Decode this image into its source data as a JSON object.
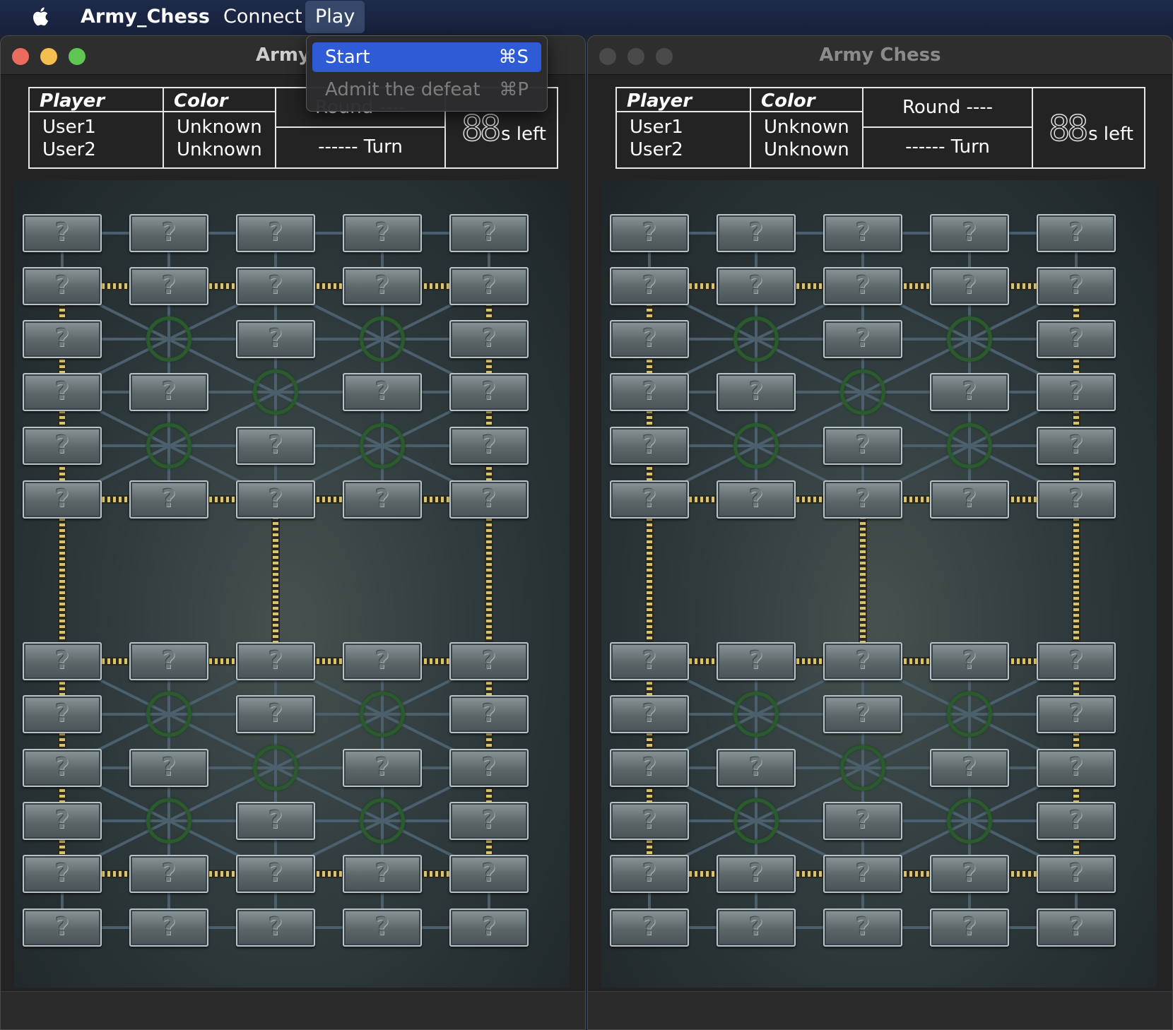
{
  "menubar": {
    "apple_icon": "apple-logo-icon",
    "app_name": "Army_Chess",
    "items": [
      "Connect",
      "Play"
    ]
  },
  "play_menu": {
    "items": [
      {
        "label": "Start",
        "shortcut": "⌘S",
        "enabled": true,
        "highlighted": true
      },
      {
        "label": "Admit the defeat",
        "shortcut": "⌘P",
        "enabled": false,
        "highlighted": false
      }
    ]
  },
  "windows": [
    {
      "title": "Army Chess",
      "title_visible": "Army C",
      "active": true,
      "info": {
        "player_header": "Player",
        "color_header": "Color",
        "players": [
          "User1",
          "User2"
        ],
        "colors": [
          "Unknown",
          "Unknown"
        ],
        "round": "Round ----",
        "turn": "------ Turn",
        "timer_digits": "88",
        "timer_label": "s left"
      }
    },
    {
      "title": "Army Chess",
      "title_visible": "Army Chess",
      "active": false,
      "info": {
        "player_header": "Player",
        "color_header": "Color",
        "players": [
          "User1",
          "User2"
        ],
        "colors": [
          "Unknown",
          "Unknown"
        ],
        "round": "Round ----",
        "turn": "------ Turn",
        "timer_digits": "88",
        "timer_label": "s left"
      }
    }
  ],
  "board": {
    "columns": 5,
    "rows": 12,
    "piece_label": "?",
    "camp_positions": [
      [
        2,
        1
      ],
      [
        2,
        3
      ],
      [
        3,
        2
      ],
      [
        4,
        1
      ],
      [
        4,
        3
      ],
      [
        7,
        1
      ],
      [
        7,
        3
      ],
      [
        8,
        2
      ],
      [
        9,
        1
      ],
      [
        9,
        3
      ]
    ],
    "colors": {
      "camp_ring": "#2b5a2e",
      "railway": "#d9c46a",
      "piece": "#6b7577"
    }
  }
}
